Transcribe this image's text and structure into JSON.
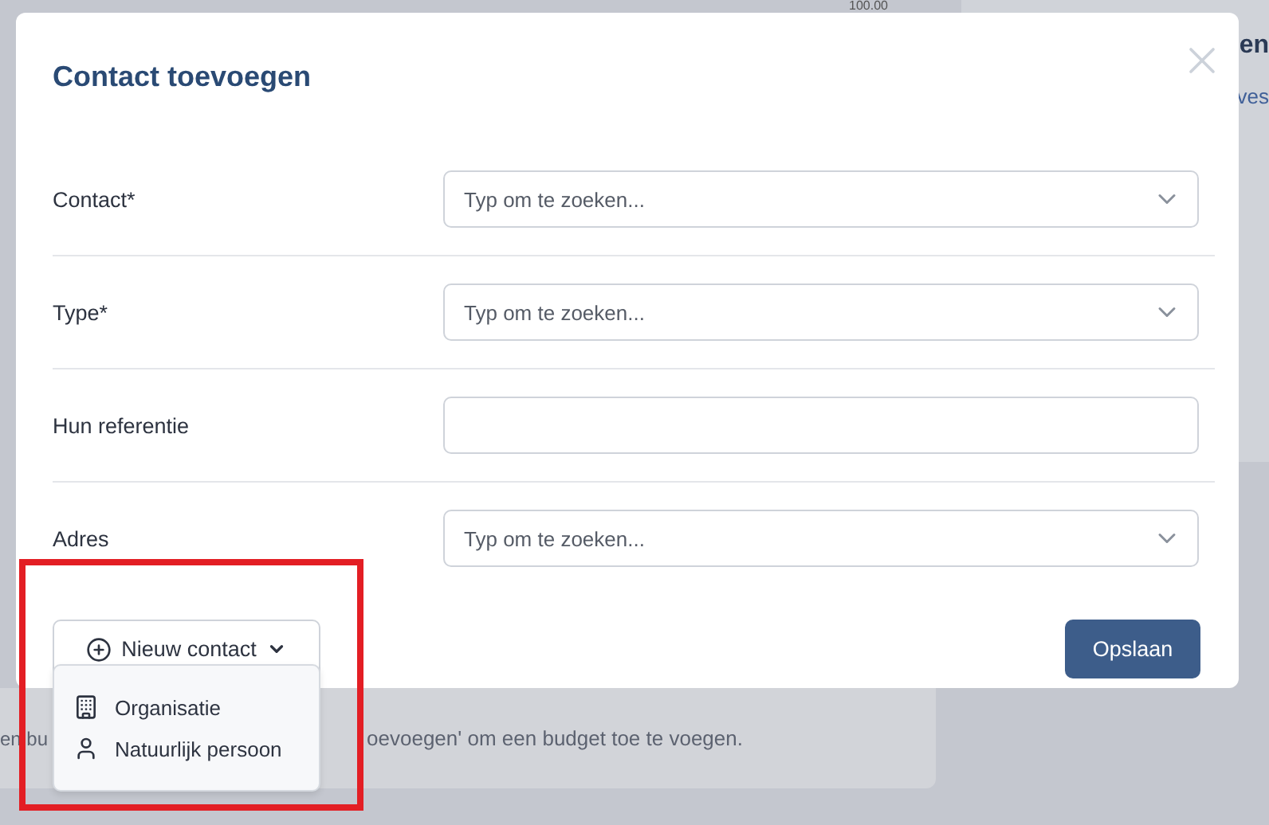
{
  "background": {
    "amount": "100.00",
    "panel_title": "en",
    "panel_link": "ves",
    "budget_text_start": "en bu",
    "budget_text_end": "oevoegen' om een budget toe te voegen."
  },
  "dialog": {
    "title": "Contact toevoegen",
    "fields": [
      {
        "label": "Contact*",
        "kind": "select",
        "placeholder": "Typ om te zoeken..."
      },
      {
        "label": "Type*",
        "kind": "select",
        "placeholder": "Typ om te zoeken..."
      },
      {
        "label": "Hun referentie",
        "kind": "text"
      },
      {
        "label": "Adres",
        "kind": "select",
        "placeholder": "Typ om te zoeken..."
      }
    ],
    "new_contact_button": {
      "label": "Nieuw contact",
      "expanded": true
    },
    "menu": [
      {
        "label": "Organisatie",
        "kind": "organization"
      },
      {
        "label": "Natuurlijk persoon",
        "kind": "person"
      }
    ],
    "save_button": "Opslaan"
  },
  "annotation": {
    "kind": "highlight",
    "color": "#e31e24"
  }
}
